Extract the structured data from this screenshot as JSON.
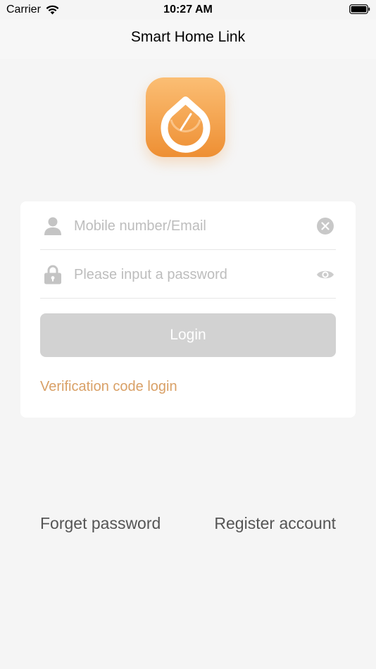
{
  "status_bar": {
    "carrier": "Carrier",
    "time": "10:27 AM"
  },
  "nav": {
    "title": "Smart Home Link"
  },
  "form": {
    "account_placeholder": "Mobile number/Email",
    "account_value": "",
    "password_placeholder": "Please input a password",
    "password_value": "",
    "login_label": "Login",
    "verification_link": "Verification code login"
  },
  "footer": {
    "forget_label": "Forget password",
    "register_label": "Register account"
  },
  "colors": {
    "accent": "#d9a066",
    "logo_top": "#fbbe74",
    "logo_bottom": "#ee8f33",
    "button_disabled": "#d2d2d2"
  },
  "icons": {
    "account": "user-icon",
    "password": "lock-icon",
    "clear": "clear-icon",
    "visibility": "eye-icon"
  }
}
